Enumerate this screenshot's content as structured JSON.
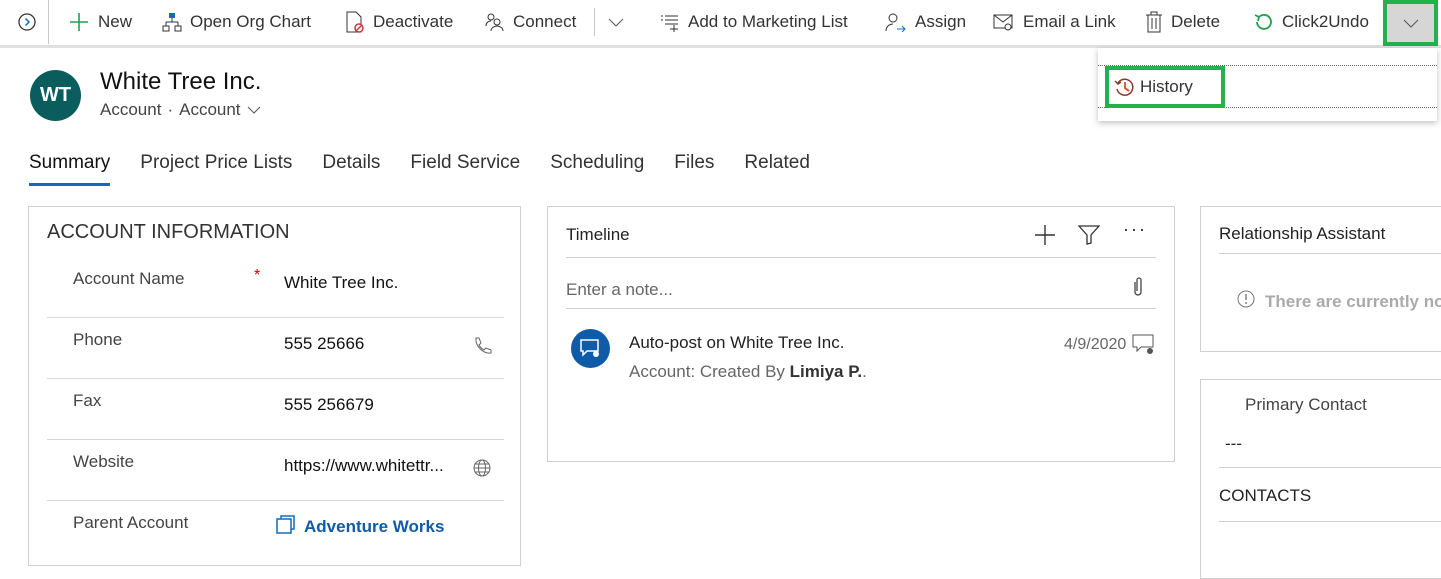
{
  "toolbar": {
    "items": [
      {
        "label": "New",
        "icon": "plus-icon"
      },
      {
        "label": "Open Org Chart",
        "icon": "org-chart-icon"
      },
      {
        "label": "Deactivate",
        "icon": "deactivate-icon"
      },
      {
        "label": "Connect",
        "icon": "connect-icon"
      },
      {
        "label": "Add to Marketing List",
        "icon": "add-list-icon"
      },
      {
        "label": "Assign",
        "icon": "assign-icon"
      },
      {
        "label": "Email a Link",
        "icon": "email-link-icon"
      },
      {
        "label": "Delete",
        "icon": "trash-icon"
      },
      {
        "label": "Click2Undo",
        "icon": "undo-icon"
      }
    ]
  },
  "more_menu": {
    "items": [
      {
        "label": "History",
        "icon": "history-icon"
      }
    ]
  },
  "header": {
    "initials": "WT",
    "title": "White Tree Inc.",
    "entity": "Account",
    "form": "Account",
    "avatar_color": "#0b5c5c"
  },
  "tabs": [
    "Summary",
    "Project Price Lists",
    "Details",
    "Field Service",
    "Scheduling",
    "Files",
    "Related"
  ],
  "account_info": {
    "title": "ACCOUNT INFORMATION",
    "fields": [
      {
        "label": "Account Name",
        "value": "White Tree Inc.",
        "required": "*"
      },
      {
        "label": "Phone",
        "value": "555 25666"
      },
      {
        "label": "Fax",
        "value": "555 256679"
      },
      {
        "label": "Website",
        "value": "https://www.whitettr..."
      },
      {
        "label": "Parent Account",
        "value": "Adventure Works"
      }
    ]
  },
  "timeline": {
    "title": "Timeline",
    "note_placeholder": "Enter a note...",
    "post": {
      "title": "Auto-post on White Tree Inc.",
      "desc": "Account: Created By",
      "author": "Limiya P.",
      "date": "4/9/2020"
    }
  },
  "relationship": {
    "title": "Relationship Assistant",
    "message": "There are currently no"
  },
  "contact": {
    "label": "Primary Contact",
    "value": "---",
    "section": "CONTACTS"
  }
}
